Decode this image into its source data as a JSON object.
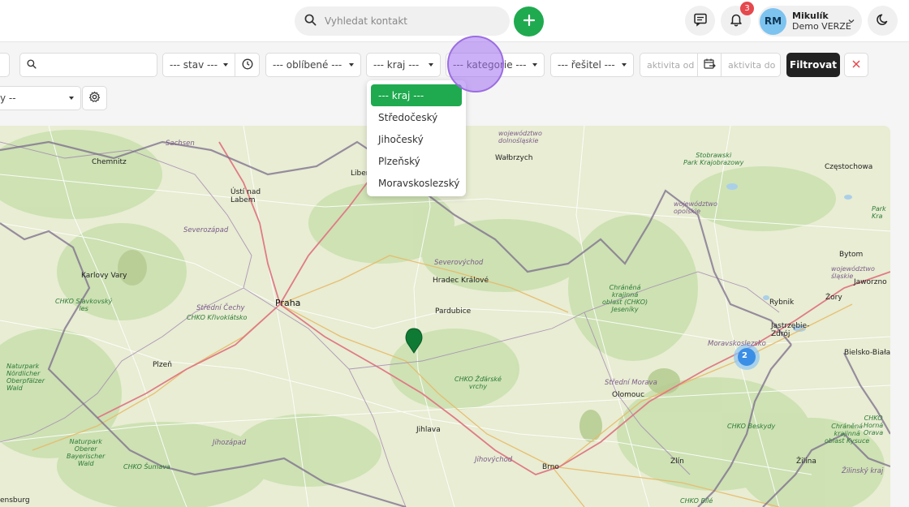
{
  "topbar": {
    "search_placeholder": "Vyhledat kontakt",
    "notifications_count": "3",
    "user": {
      "initials": "RM",
      "name": "Mikulík",
      "subtitle": "Demo VERZE"
    }
  },
  "filters": {
    "stav": "--- stav ---",
    "oblibene": "--- oblíbené ---",
    "kraj": "--- kraj ---",
    "kategorie": "--- kategorie ---",
    "resitel": "--- řešitel ---",
    "aktivita_od": "aktivita od",
    "aktivita_do": "aktivita do",
    "filter_button": "Filtrovat",
    "second_row_select": "y --"
  },
  "kraj_dropdown": {
    "options": [
      "--- kraj ---",
      "Středočeský",
      "Jihočeský",
      "Plzeňský",
      "Moravskoslezský"
    ],
    "selected": "--- kraj ---"
  },
  "map": {
    "cluster_count": "2",
    "labels": {
      "sachsen": "Sachsen",
      "chemnitz": "Chemnitz",
      "usti": "Ústí nad\nLabem",
      "severozapad": "Severozápad",
      "karlovy_vary": "Karlovy Vary",
      "chko_slavkovsky": "CHKO Slavkovský\nles",
      "stredni_cechy": "Střední Čechy",
      "chko_krivoklatsko": "CHKO Křivoklátsko",
      "praha": "Praha",
      "plzen": "Plzeň",
      "naturpark_nordlicher": "Naturpark\nNördlicher\nOberpfälzer\nWald",
      "naturpark_oberer": "Naturpark\nOberer\nBayerischer\nWald",
      "chko_sumava": "CHKO Šumava",
      "jihozapad": "Jihozápad",
      "ensburg": "ensburg",
      "liberec": "Liber",
      "severovychod": "Severovýchod",
      "hradec": "Hradec Králové",
      "pardubice": "Pardubice",
      "chko_zdarske": "CHKO Žďárské\nvrchy",
      "jihlava": "Jihlava",
      "jihovychod": "Jihovýchod",
      "brno": "Brno",
      "walbrzych": "Wałbrzych",
      "woj_dolnoslaskie": "województwo\ndolnośląskie",
      "stobrawski": "Stobrawski\nPark Krajobrazowy",
      "woj_opolskie": "województwo\nopolskie",
      "czestochowa": "Częstochowa",
      "bytom": "Bytom",
      "woj_slaskie": "województwo\nśląskie",
      "jaworzno": "Jaworzno",
      "park_kra": "Park\nKra",
      "rybnik": "Rybnik",
      "zory": "Żory",
      "jastrzebie": "Jastrzębie-\nZdrój",
      "bielsko": "Bielsko-Biała",
      "chko_jeseniky": "Chráněná\nkrajinná\noblast (CHKO)\nJeseníky",
      "moravskoslezsko": "Moravskoslezsko",
      "stredni_morava": "Střední Morava",
      "olomouc": "Olomouc",
      "chko_beskydy": "CHKO Beskydy",
      "chko_orava": "CHKO\nHorná\nOrava",
      "chko_kysuce": "Chráněná\nkrajinná\noblast Kysuce",
      "zlin": "Zlín",
      "zilina": "Žilina",
      "zilinsky": "Žilinský kraj",
      "chko_bile": "CHKO Bílé"
    }
  }
}
